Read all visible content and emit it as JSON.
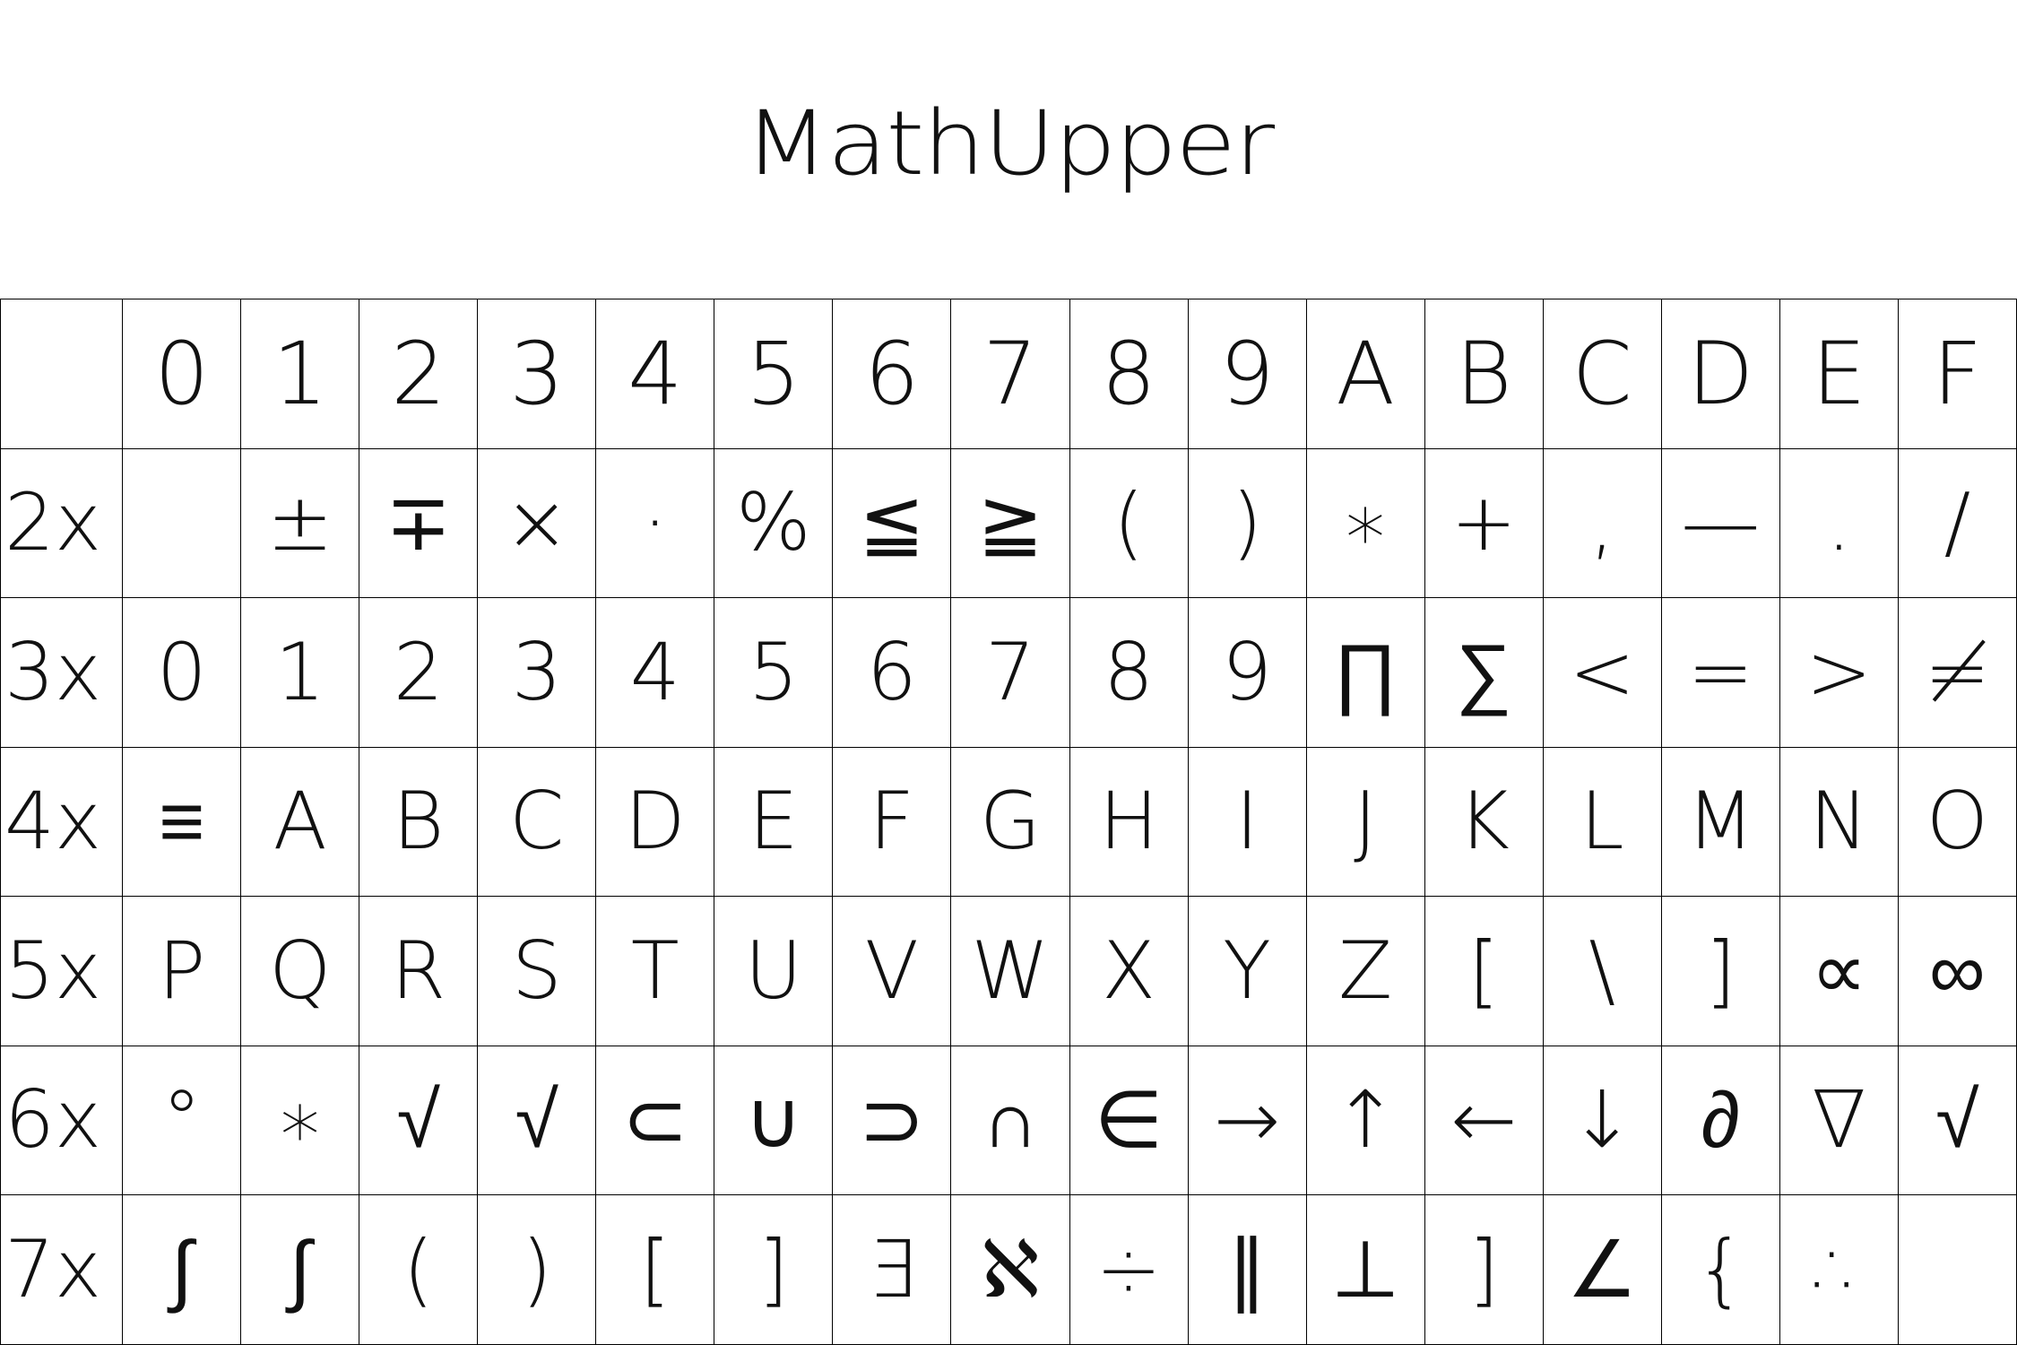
{
  "title": "MathUpper",
  "columns": [
    "0",
    "1",
    "2",
    "3",
    "4",
    "5",
    "6",
    "7",
    "8",
    "9",
    "A",
    "B",
    "C",
    "D",
    "E",
    "F"
  ],
  "rows": [
    {
      "label": "2x",
      "cells": [
        "",
        "±",
        "∓",
        "×",
        "·",
        "%",
        "≦",
        "≧",
        "(",
        ")",
        "∗",
        "+",
        ",",
        "—",
        ".",
        "/"
      ]
    },
    {
      "label": "3x",
      "cells": [
        "0",
        "1",
        "2",
        "3",
        "4",
        "5",
        "6",
        "7",
        "8",
        "9",
        "∏",
        "∑",
        "<",
        "=",
        ">",
        "≠"
      ]
    },
    {
      "label": "4x",
      "cells": [
        "≡",
        "A",
        "B",
        "C",
        "D",
        "E",
        "F",
        "G",
        "H",
        "I",
        "J",
        "K",
        "L",
        "M",
        "N",
        "O"
      ]
    },
    {
      "label": "5x",
      "cells": [
        "P",
        "Q",
        "R",
        "S",
        "T",
        "U",
        "V",
        "W",
        "X",
        "Y",
        "Z",
        "[",
        "\\",
        "]",
        "∝",
        "∞"
      ]
    },
    {
      "label": "6x",
      "cells": [
        "°",
        "∗",
        "√",
        "√",
        "⊂",
        "∪",
        "⊃",
        "∩",
        "∈",
        "→",
        "↑",
        "←",
        "↓",
        "∂",
        "∇",
        "√"
      ]
    },
    {
      "label": "7x",
      "cells": [
        "∫",
        "∫",
        "(",
        ")",
        "[",
        "]",
        "∃",
        "ℵ",
        "÷",
        "∥",
        "⊥",
        "]",
        "∠",
        "{",
        "∴",
        ""
      ]
    }
  ]
}
